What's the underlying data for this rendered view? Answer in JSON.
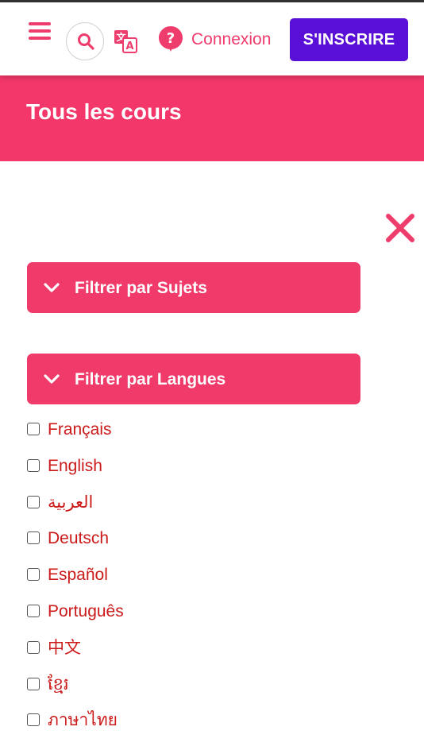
{
  "header": {
    "menu_icon": "hamburger-icon",
    "search_icon": "search-icon",
    "translate_icon": "translate-icon",
    "help_icon": "help-icon",
    "login_label": "Connexion",
    "signup_label": "S'INSCRIRE",
    "colors": {
      "accent": "#ee3c6d",
      "signup_bg": "#5a0fd6"
    }
  },
  "page": {
    "title": "Tous les cours",
    "title_band_color": "#f4376b"
  },
  "filters": {
    "close_icon": "close-icon",
    "subjects_label": "Filtrer par Sujets",
    "languages_label": "Filtrer par Langues",
    "panel_color": "#ef3a6a"
  },
  "languages": [
    {
      "label": "Français",
      "checked": false
    },
    {
      "label": "English",
      "checked": false
    },
    {
      "label": "العربية",
      "checked": false
    },
    {
      "label": "Deutsch",
      "checked": false
    },
    {
      "label": "Español",
      "checked": false
    },
    {
      "label": "Português",
      "checked": false
    },
    {
      "label": "中文",
      "checked": false
    },
    {
      "label": "ខ្មែរ",
      "checked": false
    },
    {
      "label": "ภาษาไทย",
      "checked": false
    }
  ]
}
